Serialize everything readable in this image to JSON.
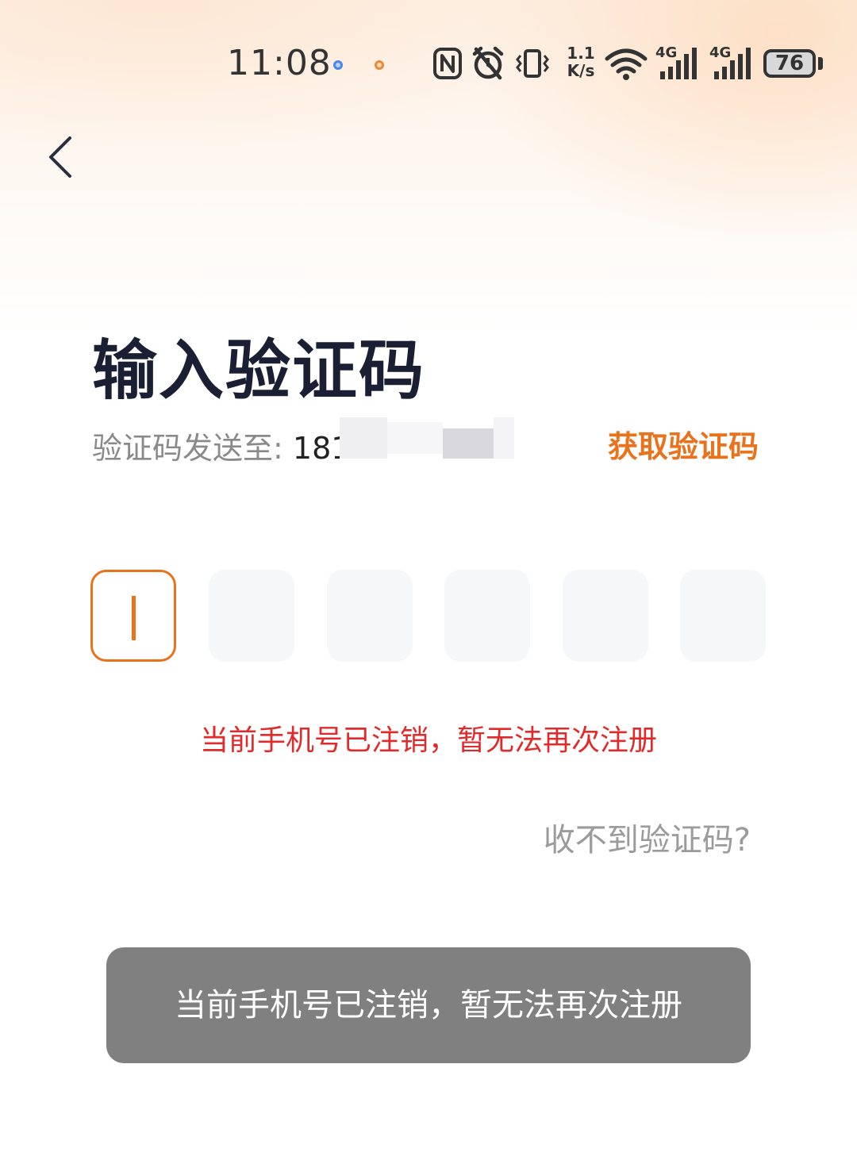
{
  "status_bar": {
    "time": "11:08",
    "net_speed_value": "1.1",
    "net_speed_unit": "K/s",
    "network_1": "4G",
    "network_2": "4G",
    "battery": "76"
  },
  "icons": {
    "back": "chevron-left-icon",
    "nfc": "nfc-icon",
    "alarm": "alarm-icon",
    "vibrate": "vibrate-icon",
    "wifi": "wifi-icon",
    "signal": "signal-icon",
    "battery": "battery-icon"
  },
  "colors": {
    "accent": "#e8731c",
    "error": "#e12a2a",
    "title": "#1a1f33",
    "toast_bg": "#808080"
  },
  "page": {
    "title": "输入验证码",
    "sent_to_label": "验证码发送至: ",
    "phone_visible_prefix": "181",
    "get_code_label": "获取验证码",
    "error_message": "当前手机号已注销，暂无法再次注册",
    "no_code_link": "收不到验证码?"
  },
  "code_input": {
    "length": 6,
    "active_index": 0,
    "values": [
      "",
      "",
      "",
      "",
      "",
      ""
    ]
  },
  "toast": {
    "message": "当前手机号已注销，暂无法再次注册"
  }
}
